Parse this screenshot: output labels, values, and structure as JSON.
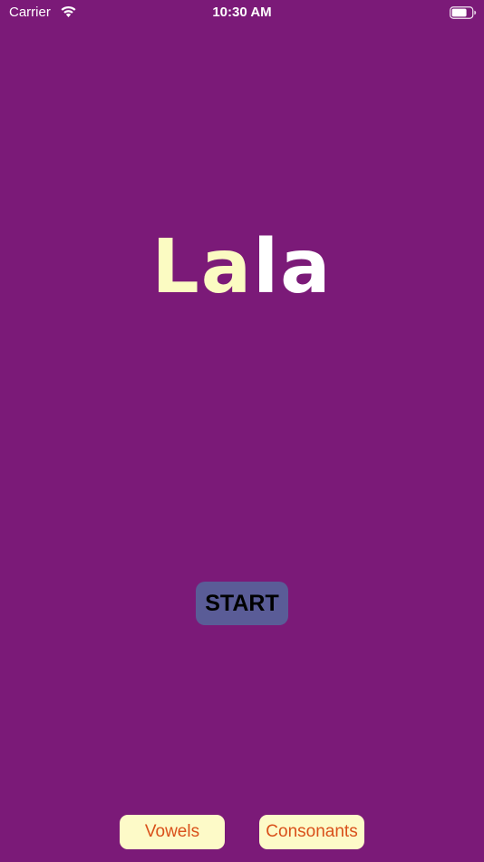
{
  "status_bar": {
    "carrier": "Carrier",
    "time": "10:30 AM",
    "wifi_icon": "wifi-icon",
    "battery_icon": "battery-icon"
  },
  "title": {
    "first": "La",
    "second": "la"
  },
  "start_label": "START",
  "bottom": {
    "vowels_label": "Vowels",
    "consonants_label": "Consonants"
  },
  "colors": {
    "background": "#7b1a78",
    "title_first": "#fbfbc2",
    "title_second": "#ffffff",
    "start_button": "#5a5c97",
    "bottom_button": "#fdfac8",
    "bottom_text": "#d9501a"
  }
}
